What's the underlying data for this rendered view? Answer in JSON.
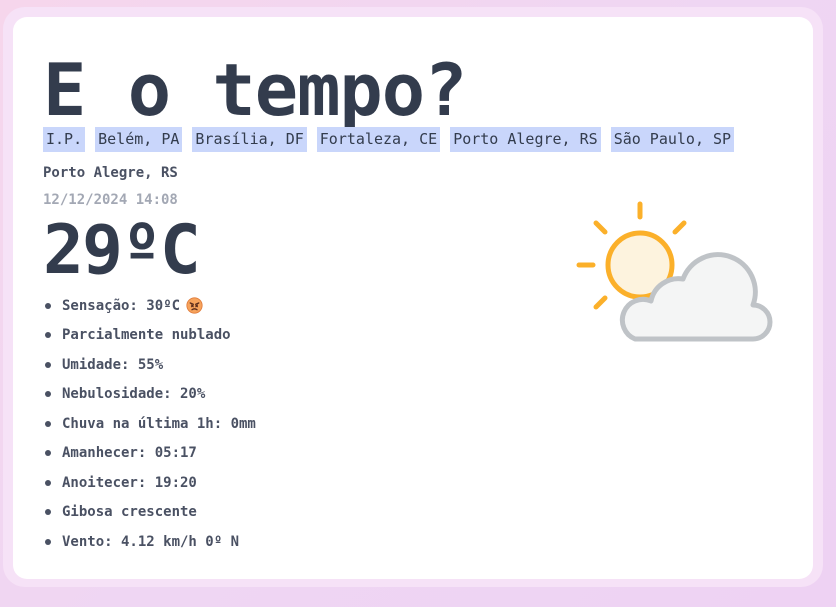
{
  "header": {
    "title": "E o tempo?"
  },
  "cities": [
    {
      "label": "I.P."
    },
    {
      "label": "Belém, PA"
    },
    {
      "label": "Brasília, DF"
    },
    {
      "label": "Fortaleza, CE"
    },
    {
      "label": "Porto Alegre, RS"
    },
    {
      "label": "São Paulo, SP"
    }
  ],
  "current": {
    "location": "Porto Alegre, RS",
    "datetime": "12/12/2024 14:08",
    "temperature": "29ºC",
    "condition_icon": "partly-cloudy-icon"
  },
  "details": [
    {
      "text": "Sensação: 30ºC",
      "icon": "angry-face-emoji-icon"
    },
    {
      "text": "Parcialmente nublado"
    },
    {
      "text": "Umidade: 55%"
    },
    {
      "text": "Nebulosidade: 20%"
    },
    {
      "text": "Chuva na última 1h: 0mm"
    },
    {
      "text": "Amanhecer: 05:17"
    },
    {
      "text": "Anoitecer: 19:20"
    },
    {
      "text": "Gibosa crescente"
    },
    {
      "text": "Vento: 4.12 km/h 0º N"
    }
  ],
  "colors": {
    "city_highlight": "#c9d6fb",
    "text_primary": "#333c4d",
    "sun": "#fbb02a",
    "cloud_stroke": "#bfc3c7",
    "cloud_fill": "#f4f5f5"
  }
}
